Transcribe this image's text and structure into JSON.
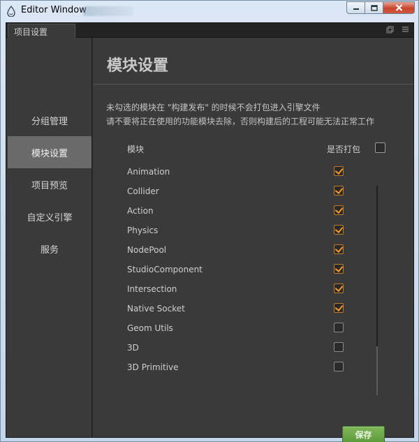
{
  "window": {
    "title": "Editor Window"
  },
  "tab": {
    "label": "项目设置"
  },
  "sidebar": {
    "items": [
      {
        "label": "分组管理",
        "active": false
      },
      {
        "label": "模块设置",
        "active": true
      },
      {
        "label": "项目预览",
        "active": false
      },
      {
        "label": "自定义引擎",
        "active": false
      },
      {
        "label": "服务",
        "active": false
      }
    ]
  },
  "main": {
    "title": "模块设置",
    "description_line1": "未勾选的模块在 \"构建发布\" 的时候不会打包进入引擎文件",
    "description_line2": "请不要将正在使用的功能模块去除，否则构建后的工程可能无法正常工作",
    "column_module": "模块",
    "column_pack": "是否打包",
    "modules": [
      {
        "name": "Animation",
        "checked": true
      },
      {
        "name": "Collider",
        "checked": true
      },
      {
        "name": "Action",
        "checked": true
      },
      {
        "name": "Physics",
        "checked": true
      },
      {
        "name": "NodePool",
        "checked": true
      },
      {
        "name": "StudioComponent",
        "checked": true
      },
      {
        "name": "Intersection",
        "checked": true
      },
      {
        "name": "Native Socket",
        "checked": true
      },
      {
        "name": "Geom Utils",
        "checked": false
      },
      {
        "name": "3D",
        "checked": false
      },
      {
        "name": "3D Primitive",
        "checked": false
      }
    ],
    "save_label": "保存"
  },
  "colors": {
    "accent_checkbox": "#f0962b",
    "save_button": "#6aa844",
    "active_nav": "#6a6a6a"
  }
}
